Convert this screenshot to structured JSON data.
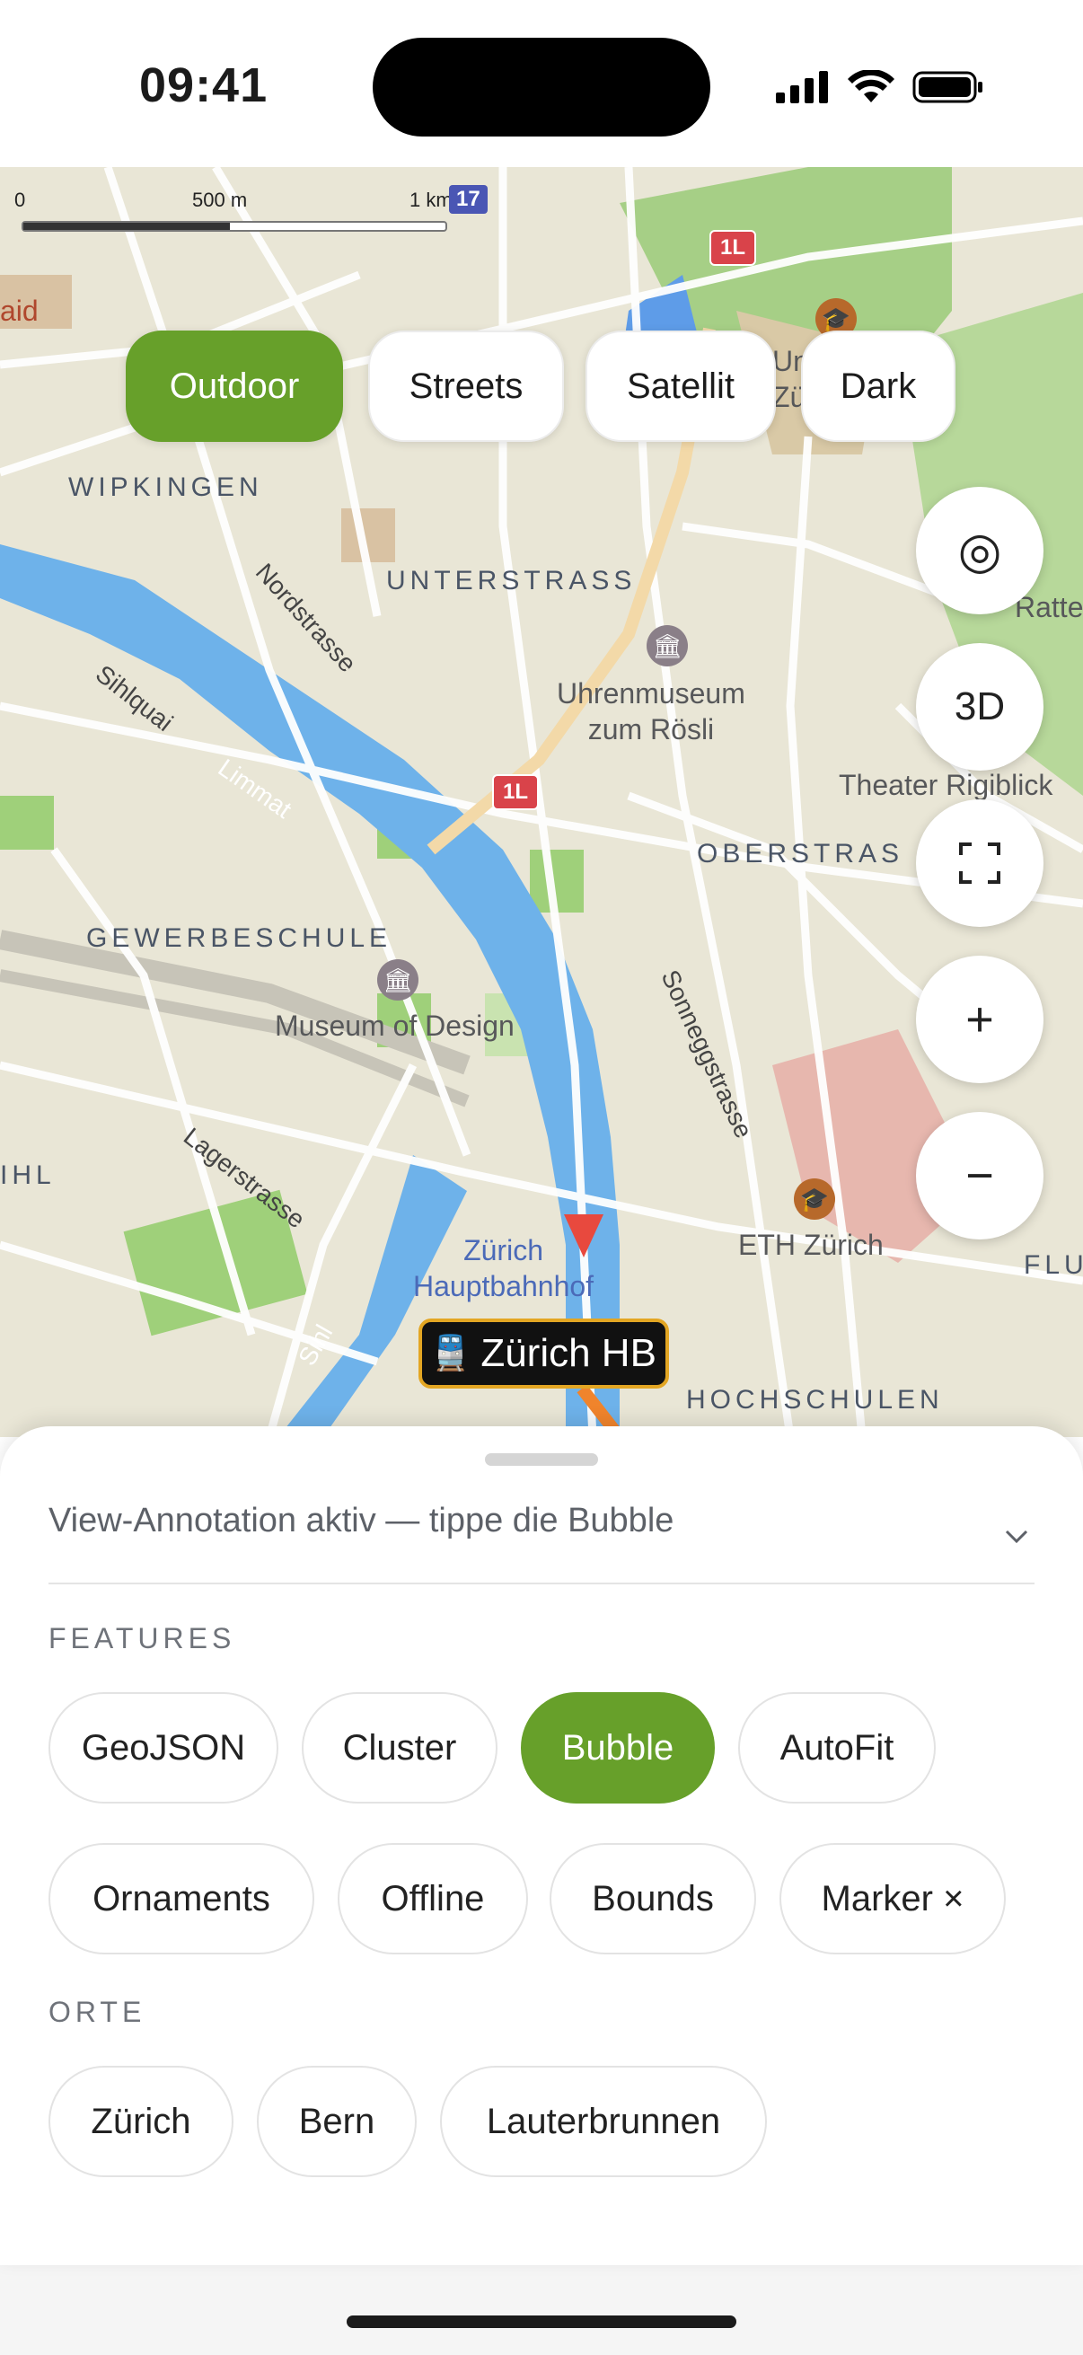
{
  "status_bar": {
    "time": "09:41"
  },
  "map": {
    "scale": {
      "zero": "0",
      "mid": "500 m",
      "end": "1 km"
    },
    "route_badge": "17",
    "shields": [
      "1L",
      "1L"
    ],
    "districts": [
      "WIPKINGEN",
      "UNTERSTRASS",
      "OBERSTRAS",
      "GEWERBESCHULE",
      "HOCHSCHULEN",
      "IHL",
      "FLU"
    ],
    "streets": [
      "Nordstrasse",
      "Sihlquai",
      "Limmat",
      "Lagerstrasse",
      "Sonneggstrasse",
      "Sihl"
    ],
    "pois": [
      "Uhrenmuseum\nzum Rösli",
      "Museum of Design",
      "ETH Zürich",
      "Theater Rigiblick",
      "Zürich\nHauptbahnhof",
      "aid",
      "Uni\nZür",
      "Ratten"
    ],
    "style_options": [
      {
        "label": "Outdoor",
        "active": true
      },
      {
        "label": "Streets",
        "active": false
      },
      {
        "label": "Satellit",
        "active": false
      },
      {
        "label": "Dark",
        "active": false
      }
    ],
    "controls": {
      "compass": "◎",
      "three_d": "3D",
      "fullscreen": "⛶",
      "zoom_in": "+",
      "zoom_out": "−"
    },
    "bubble": {
      "icon": "🚆",
      "label": "Zürich HB"
    },
    "colors": {
      "accent": "#67a02a",
      "water": "#6eb2ea",
      "route": "#f0842c",
      "pin": "#e8493e"
    }
  },
  "sheet": {
    "status_text": "View-Annotation aktiv — tippe die Bubble",
    "chevron": "⌄",
    "features_title": "FEATURES",
    "features": [
      {
        "label": "GeoJSON",
        "active": false
      },
      {
        "label": "Cluster",
        "active": false
      },
      {
        "label": "Bubble",
        "active": true
      },
      {
        "label": "AutoFit",
        "active": false
      },
      {
        "label": "Ornaments",
        "active": false
      },
      {
        "label": "Offline",
        "active": false
      },
      {
        "label": "Bounds",
        "active": false
      },
      {
        "label": "Marker ×",
        "active": false
      }
    ],
    "places_title": "ORTE",
    "places": [
      {
        "label": "Zürich"
      },
      {
        "label": "Bern"
      },
      {
        "label": "Lauterbrunnen"
      }
    ]
  }
}
